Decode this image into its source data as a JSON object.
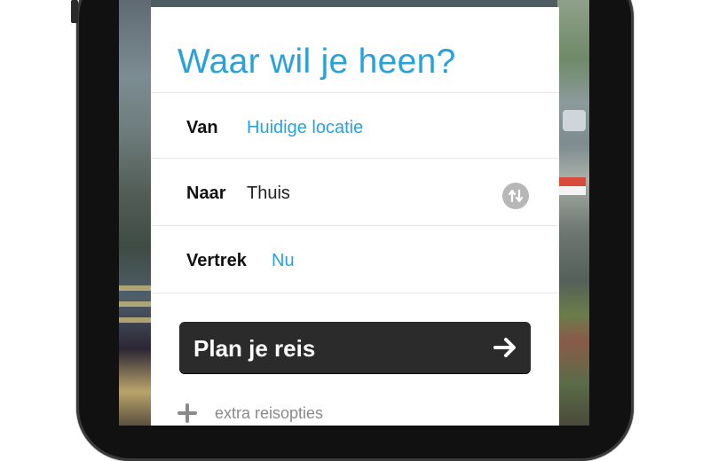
{
  "header": {
    "title": "Waar wil je heen?"
  },
  "form": {
    "from": {
      "label": "Van",
      "value": "Huidige locatie"
    },
    "to": {
      "label": "Naar",
      "value": "Thuis",
      "swap_icon": "swap-arrows-icon"
    },
    "depart": {
      "label": "Vertrek",
      "value": "Nu"
    }
  },
  "actions": {
    "plan_label": "Plan je reis",
    "plan_icon": "arrow-right-icon",
    "extra_label": "extra reisopties",
    "extra_icon": "plus-icon"
  },
  "colors": {
    "accent": "#27a2db",
    "button": "#2b2b2b",
    "muted": "#8a8a8a"
  }
}
